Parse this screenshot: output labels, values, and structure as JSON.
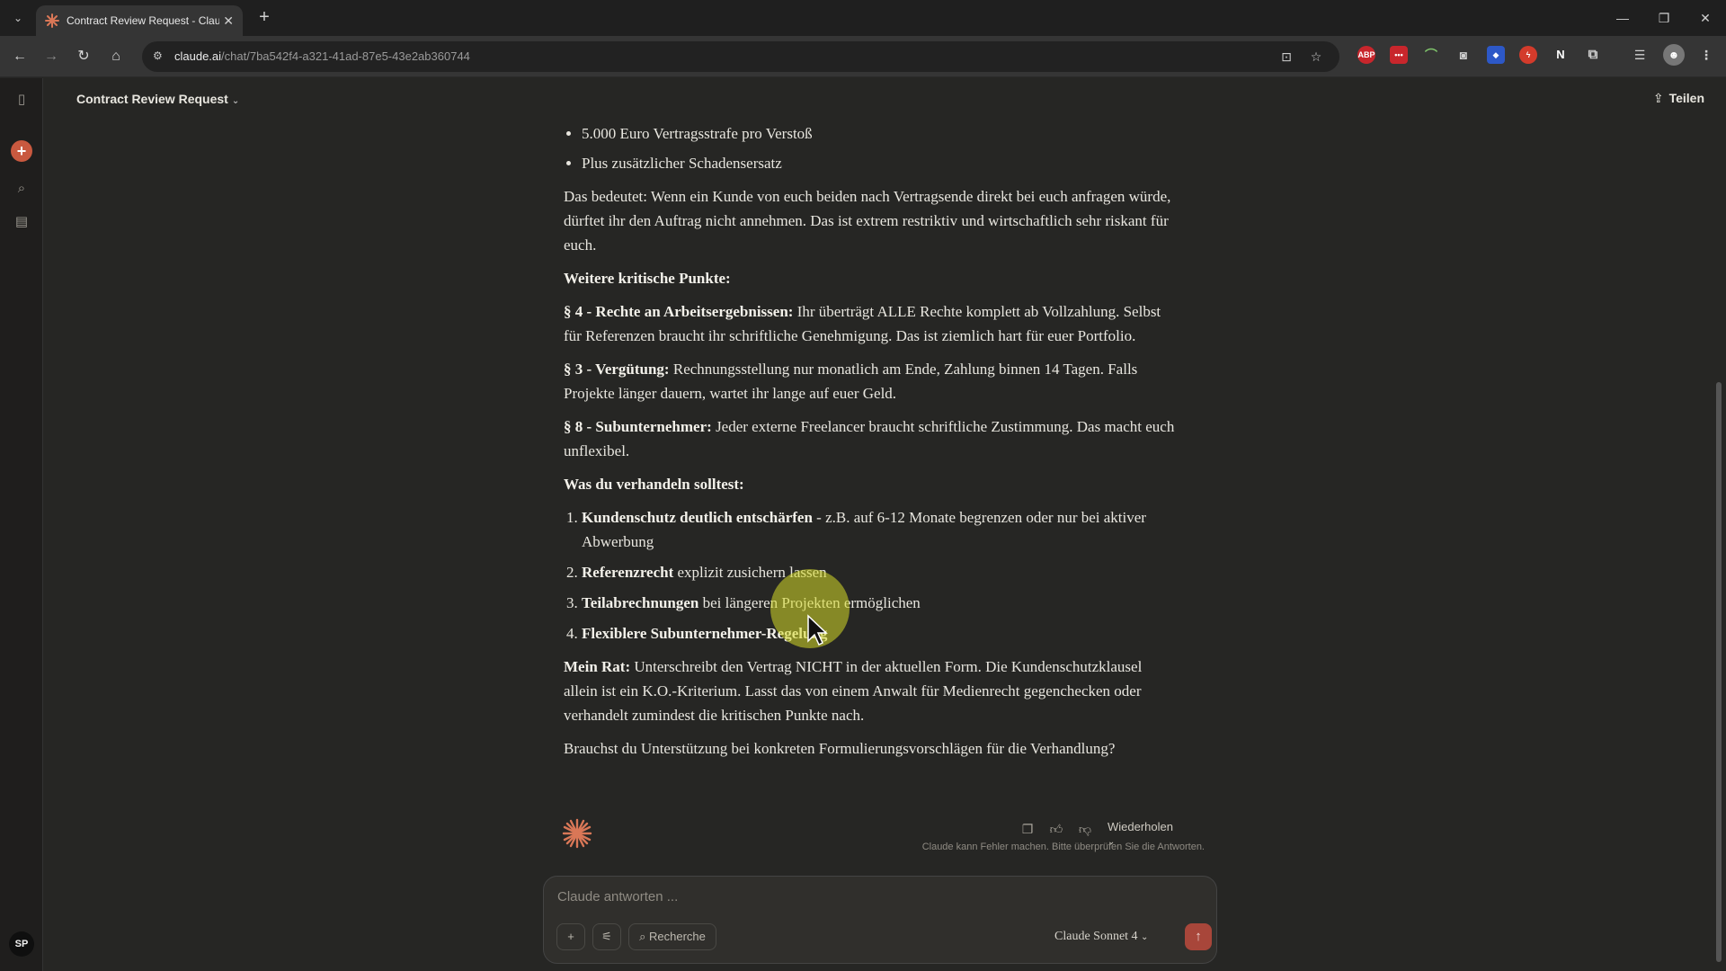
{
  "browser": {
    "tab_title": "Contract Review Request - Clau",
    "url_host": "claude.ai",
    "url_path": "/chat/7ba542f4-a321-41ad-87e5-43e2ab360744",
    "extensions": [
      "ABP",
      "•••",
      "N"
    ]
  },
  "header": {
    "title": "Contract Review Request",
    "share_label": "Teilen"
  },
  "sidebar": {
    "avatar_initials": "SP"
  },
  "message": {
    "bullets": [
      "5.000 Euro Vertragsstrafe pro Verstoß",
      "Plus zusätzlicher Schadensersatz"
    ],
    "p1": "Das bedeutet: Wenn ein Kunde von euch beiden nach Vertragsende direkt bei euch anfragen würde, dürftet ihr den Auftrag nicht annehmen. Das ist extrem restriktiv und wirtschaftlich sehr riskant für euch.",
    "h_weitere": "Weitere kritische Punkte:",
    "s4_label": "§ 4 - Rechte an Arbeitsergebnissen:",
    "s4_text": " Ihr überträgt ALLE Rechte komplett ab Vollzahlung. Selbst für Referenzen braucht ihr schriftliche Genehmigung. Das ist ziemlich hart für euer Portfolio.",
    "s3_label": "§ 3 - Vergütung:",
    "s3_text": " Rechnungsstellung nur monatlich am Ende, Zahlung binnen 14 Tagen. Falls Projekte länger dauern, wartet ihr lange auf euer Geld.",
    "s8_label": "§ 8 - Subunternehmer:",
    "s8_text": " Jeder externe Freelancer braucht schriftliche Zustimmung. Das macht euch unflexibel.",
    "h_verhandeln": "Was du verhandeln solltest:",
    "ol": [
      {
        "bold": "Kundenschutz deutlich entschärfen",
        "text": " - z.B. auf 6-12 Monate begrenzen oder nur bei aktiver Abwerbung"
      },
      {
        "bold": "Referenzrecht",
        "text": " explizit zusichern lassen"
      },
      {
        "bold": "Teilabrechnungen",
        "text": " bei längeren Projekten ermöglichen"
      },
      {
        "bold": "Flexiblere Subunternehmer-Regelung",
        "text": ""
      }
    ],
    "rat_label": "Mein Rat:",
    "rat_text": " Unterschreibt den Vertrag NICHT in der aktuellen Form. Die Kundenschutzklausel allein ist ein K.O.-Kriterium. Lasst das von einem Anwalt für Medienrecht gegenchecken oder verhandelt zumindest die kritischen Punkte nach.",
    "question": "Brauchst du Unterstützung bei konkreten Formulierungsvorschlägen für die Verhandlung?"
  },
  "actions": {
    "retry_label": "Wiederholen",
    "disclaimer": "Claude kann Fehler machen. Bitte überprüfen Sie die Antworten."
  },
  "composer": {
    "placeholder": "Claude antworten ...",
    "research_label": "Recherche",
    "model": "Claude Sonnet 4"
  },
  "colors": {
    "background": "#262624",
    "accent": "#c9593f",
    "send": "#a8463a",
    "cursor_highlight": "#d6db28"
  }
}
